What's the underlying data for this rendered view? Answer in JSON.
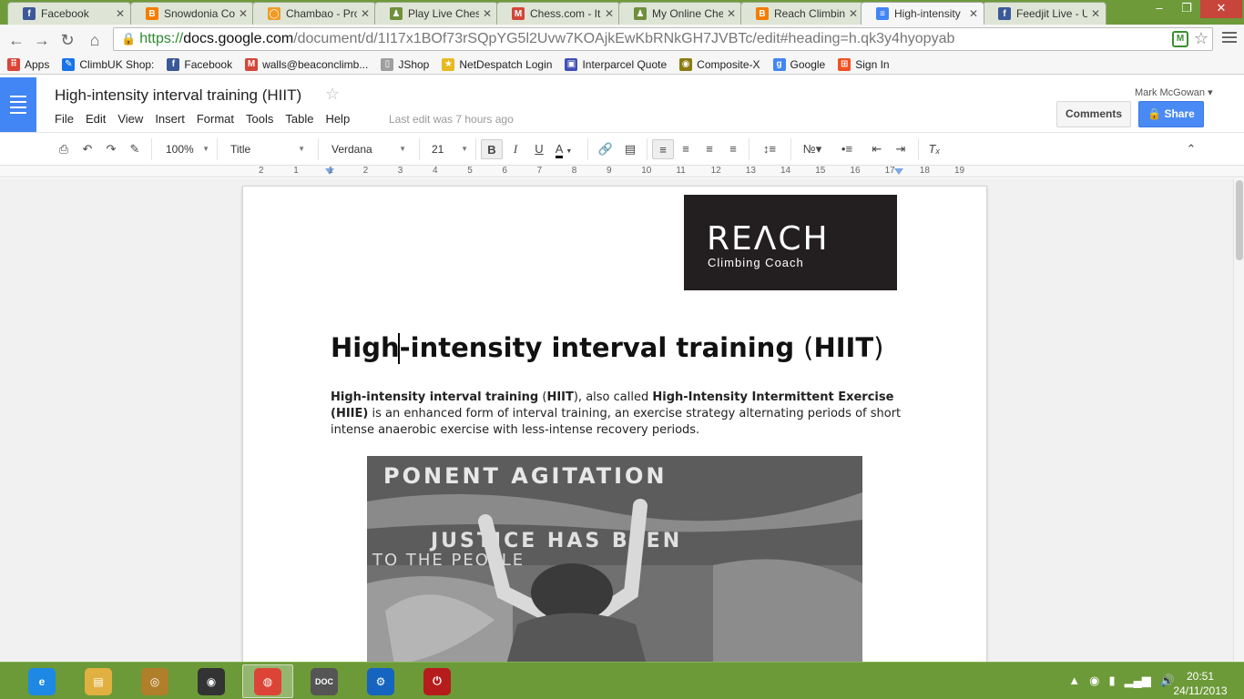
{
  "browser": {
    "tabs": [
      {
        "label": "Facebook",
        "icon": "facebook-icon",
        "color": "#3b5998",
        "glyph": "f"
      },
      {
        "label": "Snowdonia Co",
        "icon": "blogger-icon",
        "color": "#f57d00",
        "glyph": "B"
      },
      {
        "label": "Chambao - Pro",
        "icon": "radio-icon",
        "color": "#f19a24",
        "glyph": "◯"
      },
      {
        "label": "Play Live Chess",
        "icon": "chess-pawn-icon",
        "color": "#6f8f3a",
        "glyph": "♟"
      },
      {
        "label": "Chess.com - It'",
        "icon": "gmail-icon",
        "color": "#d44638",
        "glyph": "M"
      },
      {
        "label": "My Online Che",
        "icon": "chess-pawn-icon",
        "color": "#6f8f3a",
        "glyph": "♟"
      },
      {
        "label": "Reach Climbin",
        "icon": "blogger-icon",
        "color": "#f57d00",
        "glyph": "B"
      },
      {
        "label": "High-intensity",
        "icon": "google-docs-icon",
        "color": "#4285f4",
        "glyph": "≡"
      },
      {
        "label": "Feedjit Live - U",
        "icon": "facebook-icon",
        "color": "#3b5998",
        "glyph": "f"
      }
    ],
    "url_https": "https://",
    "url_domain": "docs.google.com",
    "url_path": "/document/d/1I17x1BOf73rSQpYG5l2Uvw7KOAjkEwKbRNkGH7JVBTc/edit#heading=h.qk3y4hyopyab",
    "bookmarks": [
      {
        "label": "Apps",
        "icon": "apps-grid-icon",
        "color": "#db4437",
        "glyph": "⠿"
      },
      {
        "label": "ClimbUK Shop:",
        "icon": "feather-icon",
        "color": "#1a73e8",
        "glyph": "✎"
      },
      {
        "label": "Facebook",
        "icon": "facebook-icon",
        "color": "#3b5998",
        "glyph": "f"
      },
      {
        "label": "walls@beaconclimb...",
        "icon": "gmail-icon",
        "color": "#d44638",
        "glyph": "M"
      },
      {
        "label": "JShop",
        "icon": "page-icon",
        "color": "#9e9e9e",
        "glyph": "▯"
      },
      {
        "label": "NetDespatch Login",
        "icon": "star-icon",
        "color": "#e8b923",
        "glyph": "★"
      },
      {
        "label": "Interparcel Quote",
        "icon": "parcel-icon",
        "color": "#3f51b5",
        "glyph": "▣"
      },
      {
        "label": "Composite-X",
        "icon": "composite-icon",
        "color": "#8a7a12",
        "glyph": "◉"
      },
      {
        "label": "Google",
        "icon": "google-icon",
        "color": "#4285f4",
        "glyph": "g"
      },
      {
        "label": "Sign In",
        "icon": "windows-icon",
        "color": "#f25022",
        "glyph": "⊞"
      }
    ]
  },
  "docs": {
    "title": "High-intensity interval training (HIIT)",
    "menu": [
      "File",
      "Edit",
      "View",
      "Insert",
      "Format",
      "Tools",
      "Table",
      "Help"
    ],
    "last_edit": "Last edit was 7 hours ago",
    "user": "Mark McGowan",
    "comments_label": "Comments",
    "share_label": "Share",
    "toolbar": {
      "zoom": "100%",
      "style": "Title",
      "font": "Verdana",
      "size": "21"
    },
    "ruler_numbers": [
      "2",
      "1",
      "1",
      "2",
      "3",
      "4",
      "5",
      "6",
      "7",
      "8",
      "9",
      "10",
      "11",
      "12",
      "13",
      "14",
      "15",
      "16",
      "17",
      "18",
      "19"
    ]
  },
  "document": {
    "logo_main": "REΛCH",
    "logo_sub": "Climbing Coach",
    "heading_part1": "High-intensity interval training ",
    "heading_paren_open": "(",
    "heading_abbr": "HIIT",
    "heading_paren_close": ")",
    "para": {
      "b1": "High-intensity interval training",
      "t1": " (",
      "b2": "HIIT",
      "t2": "), also called ",
      "b3": "High-Intensity Intermittent Exercise (HIIE)",
      "t3": " is an enhanced form of interval training, an exercise strategy alternating periods of short intense anaerobic exercise with less-intense recovery periods."
    },
    "photo_text": [
      "PONENT AGITATION",
      "JUSTICE HAS BEEN",
      "TO THE PEOPLE"
    ]
  },
  "taskbar": {
    "apps": [
      {
        "name": "internet-explorer-icon",
        "color": "#1e88e5",
        "glyph": "e"
      },
      {
        "name": "file-explorer-icon",
        "color": "#e0b040",
        "glyph": "▤"
      },
      {
        "name": "media-player-icon",
        "color": "#b07f2a",
        "glyph": "◎"
      },
      {
        "name": "speaker-app-icon",
        "color": "#333333",
        "glyph": "◉"
      },
      {
        "name": "chrome-icon",
        "color": "#db4437",
        "glyph": "◍"
      },
      {
        "name": "doc-app-icon",
        "color": "#555555",
        "glyph": "DOC"
      },
      {
        "name": "settings-app-icon",
        "color": "#1565c0",
        "glyph": "⚙"
      },
      {
        "name": "power-app-icon",
        "color": "#b71c1c",
        "glyph": "⏻"
      }
    ],
    "time": "20:51",
    "date": "24/11/2013"
  }
}
